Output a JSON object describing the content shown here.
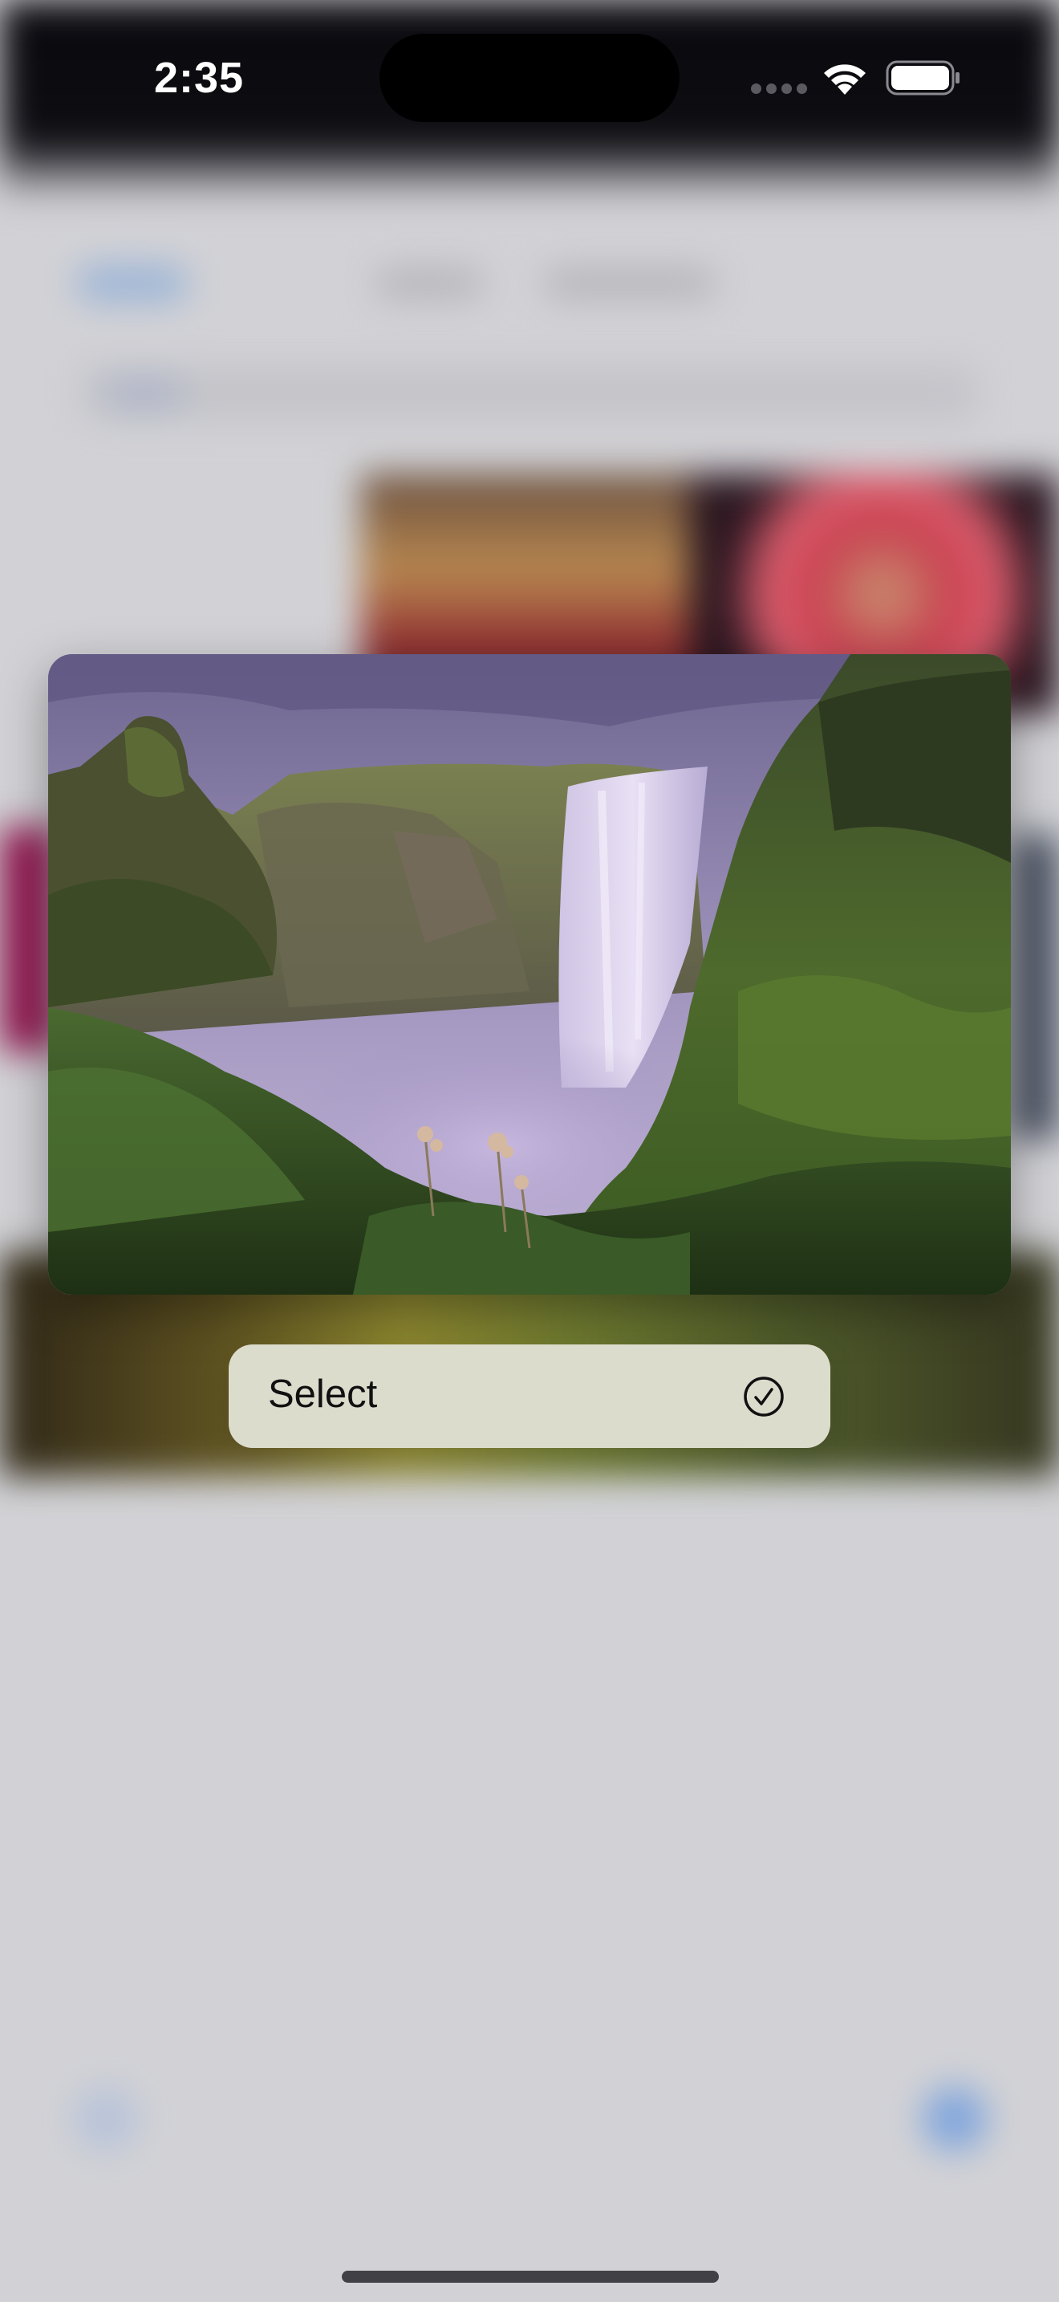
{
  "status_bar": {
    "time": "2:35",
    "icons": [
      "cellular-signal-icon",
      "wifi-icon",
      "battery-icon"
    ],
    "battery_level": 1.0
  },
  "preview": {
    "subject": "waterfall-landscape-photo",
    "colors": {
      "sky": "#8a80a8",
      "mist": "#b8a8d0",
      "moss": "#4e6a2c",
      "rock": "#5a5448"
    }
  },
  "context_menu": {
    "items": [
      {
        "label": "Select",
        "icon": "checkmark-circle-icon"
      }
    ]
  },
  "colors": {
    "menu_background": "#dcdccd",
    "background": "#d2d2d6"
  }
}
